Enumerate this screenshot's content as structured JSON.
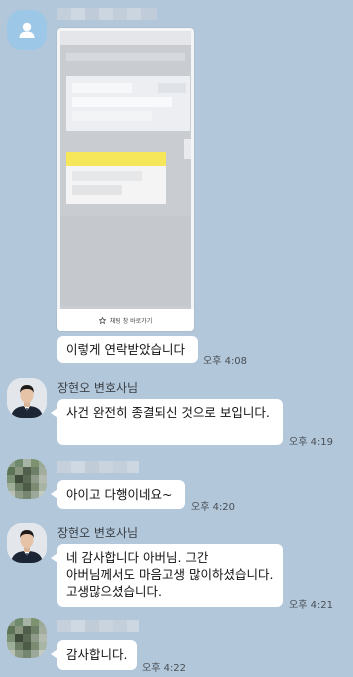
{
  "messages": [
    {
      "text": "이렇게 연락받았습니다",
      "time": "오후 4:08"
    },
    {
      "sender": "장현오 변호사님",
      "text": "사건 완전히 종결되신 것으로 보입니다.",
      "time": "오후 4:19"
    },
    {
      "text": "아이고 다행이네요~",
      "time": "오후 4:20"
    },
    {
      "sender": "장현오 변호사님",
      "text": "네 감사합니다 아버님. 그간 아버님께서도 마음고생 많이하셨습니다. 고생많으셨습니다.",
      "time": "오후 4:21"
    },
    {
      "text": "감사합니다.",
      "time": "오후 4:22"
    }
  ],
  "attachment": {
    "bottom_label": "채팅 창 바로가기"
  },
  "colors": {
    "chat_background": "#b2c7da",
    "bubble": "#ffffff",
    "default_avatar": "#9cc7e7",
    "highlight_yellow": "#f6e65a"
  },
  "icons": {
    "default_avatar": "person-icon",
    "attachment_bottom": "star-icon"
  }
}
